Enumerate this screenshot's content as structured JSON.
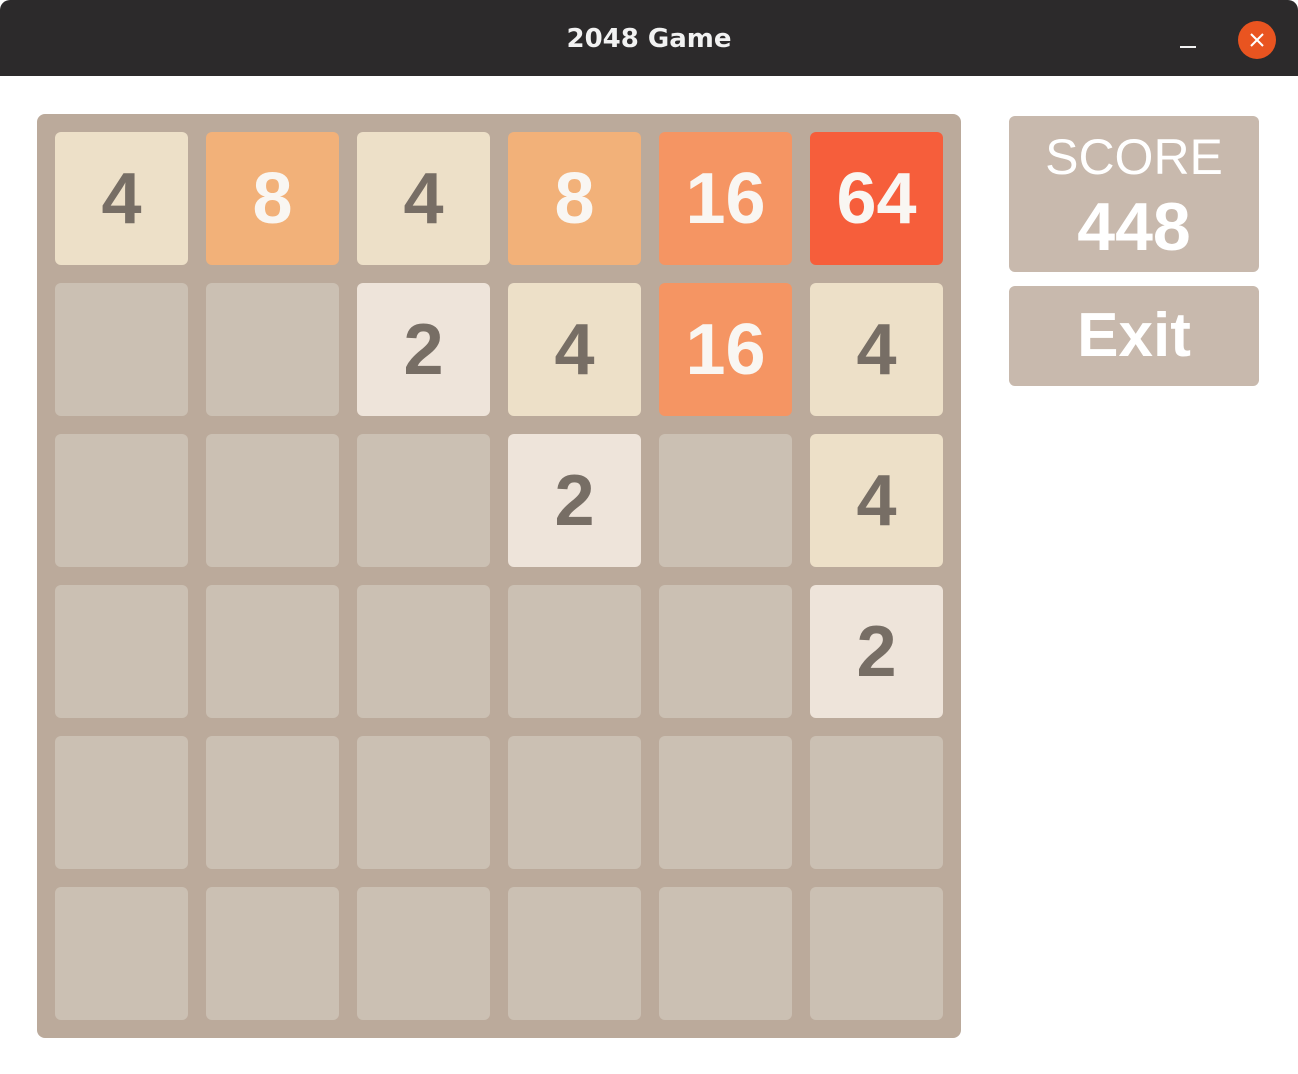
{
  "window": {
    "title": "2048 Game"
  },
  "board": {
    "rows": 6,
    "cols": 6,
    "tiles": [
      [
        "4",
        "8",
        "4",
        "8",
        "16",
        "64"
      ],
      [
        "",
        "",
        "2",
        "4",
        "16",
        "4"
      ],
      [
        "",
        "",
        "",
        "2",
        "",
        "4"
      ],
      [
        "",
        "",
        "",
        "",
        "",
        "2"
      ],
      [
        "",
        "",
        "",
        "",
        "",
        ""
      ],
      [
        "",
        "",
        "",
        "",
        "",
        ""
      ]
    ]
  },
  "tile_colors": {
    "empty": {
      "bg": "#cbc0b3",
      "fg": "#776e65"
    },
    "2": {
      "bg": "#eee4da",
      "fg": "#776e65"
    },
    "4": {
      "bg": "#ede0c8",
      "fg": "#776e65"
    },
    "8": {
      "bg": "#f2b179",
      "fg": "#f9f6f2"
    },
    "16": {
      "bg": "#f59563",
      "fg": "#f9f6f2"
    },
    "64": {
      "bg": "#f65e3b",
      "fg": "#f9f6f2"
    }
  },
  "score": {
    "label": "SCORE",
    "value": "448"
  },
  "controls": {
    "exit_label": "Exit"
  },
  "icons": {
    "minimize": "minimize-icon",
    "close": "close-icon"
  },
  "colors": {
    "titlebar": "#2c2a2b",
    "close_button": "#e95420",
    "board_bg": "#bbaa9b",
    "panel_bg": "#c8b9ad"
  }
}
